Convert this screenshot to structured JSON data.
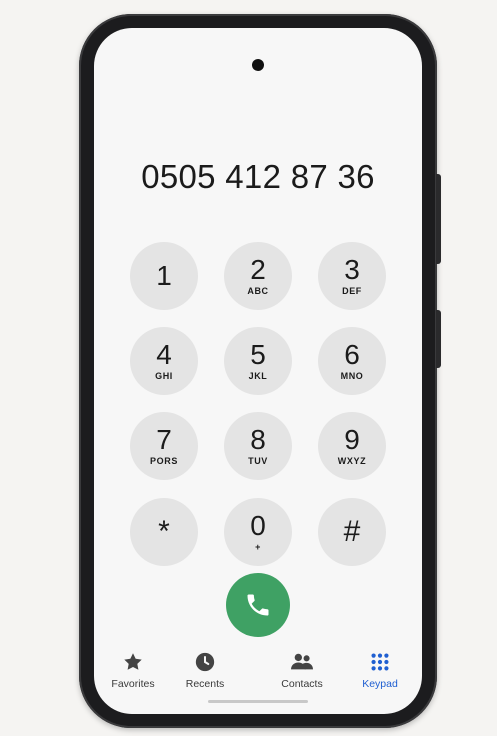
{
  "dialer": {
    "number": "0505 412 87 36"
  },
  "keys": [
    {
      "digit": "1",
      "letters": ""
    },
    {
      "digit": "2",
      "letters": "ABC"
    },
    {
      "digit": "3",
      "letters": "DEF"
    },
    {
      "digit": "4",
      "letters": "GHI"
    },
    {
      "digit": "5",
      "letters": "JKL"
    },
    {
      "digit": "6",
      "letters": "MNO"
    },
    {
      "digit": "7",
      "letters": "PORS"
    },
    {
      "digit": "8",
      "letters": "TUV"
    },
    {
      "digit": "9",
      "letters": "WXYZ"
    },
    {
      "digit": "*",
      "letters": ""
    },
    {
      "digit": "0",
      "letters": "+"
    },
    {
      "digit": "#",
      "letters": ""
    }
  ],
  "call": {
    "icon": "phone-icon",
    "color": "#3fa164"
  },
  "nav": {
    "active": "Keypad",
    "active_color": "#1f5fd1",
    "items": [
      {
        "label": "Favorites",
        "icon": "star-icon"
      },
      {
        "label": "Recents",
        "icon": "clock-icon"
      },
      {
        "label": "Contacts",
        "icon": "people-icon"
      },
      {
        "label": "Keypad",
        "icon": "dialpad-icon"
      }
    ]
  }
}
